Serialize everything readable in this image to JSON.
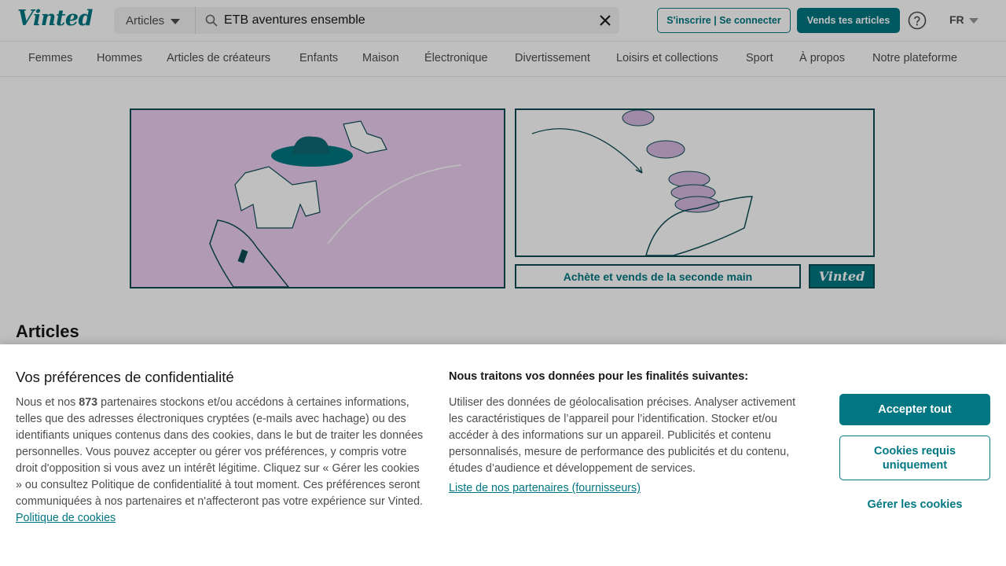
{
  "header": {
    "logo_text": "Vinted",
    "search_category": "Articles",
    "search_value": "ETB aventures ensemble",
    "signup_label": "S'inscrire | Se connecter",
    "sell_label": "Vends tes articles",
    "language": "FR"
  },
  "nav": {
    "items": [
      {
        "label": "Femmes"
      },
      {
        "label": "Hommes"
      },
      {
        "label": "Articles de créateurs"
      },
      {
        "label": "Enfants"
      },
      {
        "label": "Maison"
      },
      {
        "label": "Électronique"
      },
      {
        "label": "Divertissement"
      },
      {
        "label": "Loisirs et collections"
      },
      {
        "label": "Sport"
      },
      {
        "label": "À propos"
      },
      {
        "label": "Notre plateforme"
      }
    ]
  },
  "banner": {
    "tagline": "Achète et vends de la seconde main",
    "logo_text": "Vinted"
  },
  "main": {
    "section_title": "Articles"
  },
  "cookie": {
    "title": "Vos préférences de confidentialité",
    "text_before_count": "Nous et nos ",
    "partner_count": "873",
    "text_after_count": " partenaires stockons et/ou accédons à certaines informations, telles que des adresses électroniques cryptées (e-mails avec hachage) ou des identifiants uniques contenus dans des cookies, dans le but de traiter les données personnelles. Vous pouvez accepter ou gérer vos préférences, y compris votre droit d'opposition si vous avez un intérêt légitime. Cliquez sur « Gérer les cookies » ou consultez Politique de confidentialité à tout moment. Ces préférences seront communiquées à nos partenaires et n'affecteront pas votre expérience sur Vinted. ",
    "policy_link": "Politique de cookies",
    "purposes_title": "Nous traitons vos données pour les finalités suivantes:",
    "purposes_text": "Utiliser des données de géolocalisation précises. Analyser activement les caractéristiques de l’appareil pour l’identification. Stocker et/ou accéder à des informations sur un appareil. Publicités et contenu personnalisés, mesure de performance des publicités et du contenu, études d’audience et développement de services.",
    "partners_link": "Liste de nos partenaires (fournisseurs)",
    "accept_label": "Accepter tout",
    "required_label": "Cookies requis uniquement",
    "manage_label": "Gérer les cookies"
  },
  "colors": {
    "brand": "#007782",
    "banner_pink": "#eccff0",
    "outline": "#0d4d55"
  }
}
